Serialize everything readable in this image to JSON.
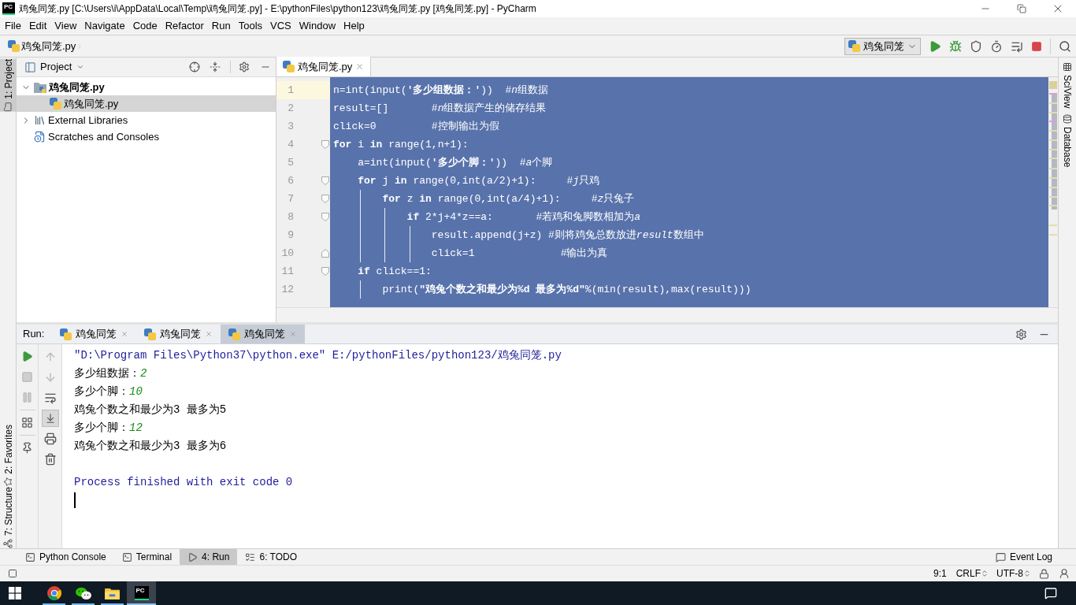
{
  "title_bar": {
    "logo": "PC",
    "title": "鸡兔同笼.py [C:\\Users\\i\\AppData\\Local\\Temp\\鸡兔同笼.py] - E:\\pythonFiles\\python123\\鸡兔同笼.py [鸡兔同笼.py] - PyCharm"
  },
  "menu": [
    "File",
    "Edit",
    "View",
    "Navigate",
    "Code",
    "Refactor",
    "Run",
    "Tools",
    "VCS",
    "Window",
    "Help"
  ],
  "breadcrumb": [
    "鸡兔同笼.py"
  ],
  "run_config": {
    "label": "鸡兔同笼"
  },
  "left_strip": [
    {
      "label": "1: Project",
      "kind": "project",
      "selected": true
    },
    {
      "label": "2: Favorites",
      "kind": "favorites",
      "selected": false
    },
    {
      "label": "7: Structure",
      "kind": "structure",
      "selected": false
    }
  ],
  "right_strip": [
    {
      "label": "SciView",
      "kind": "sciview"
    },
    {
      "label": "Database",
      "kind": "database"
    }
  ],
  "project": {
    "title": "Project",
    "tree": [
      {
        "label": "鸡兔同笼.py",
        "kind": "project",
        "expanded": true,
        "selected": false,
        "children": [
          {
            "label": "鸡兔同笼.py",
            "kind": "file",
            "selected": true
          }
        ]
      },
      {
        "label": "External Libraries",
        "kind": "libraries",
        "expanded": false,
        "selected": false
      },
      {
        "label": "Scratches and Consoles",
        "kind": "scratches",
        "selected": false
      }
    ]
  },
  "editor": {
    "tabs": [
      {
        "label": "鸡兔同笼.py",
        "selected": true
      }
    ],
    "lines": [
      {
        "number": "1",
        "kind": "plain",
        "current": true,
        "tokens": [
          {
            "kind": "plain",
            "text": "n=int(input("
          },
          {
            "kind": "str",
            "text": "'多少组数据：'"
          },
          {
            "kind": "plain",
            "text": "))  "
          },
          {
            "kind": "cmt",
            "text": "#"
          },
          {
            "kind": "cmtv",
            "text": "n"
          },
          {
            "kind": "cmt",
            "text": "组数据"
          }
        ]
      },
      {
        "number": "2",
        "kind": "plain",
        "current": false,
        "tokens": [
          {
            "kind": "plain",
            "text": "result=[]       "
          },
          {
            "kind": "cmt",
            "text": "#"
          },
          {
            "kind": "cmtv",
            "text": "n"
          },
          {
            "kind": "cmt",
            "text": "组数据产生的储存结果"
          }
        ]
      },
      {
        "number": "3",
        "kind": "plain",
        "current": false,
        "tokens": [
          {
            "kind": "plain",
            "text": "click=0         "
          },
          {
            "kind": "cmt",
            "text": "#控制输出为假"
          }
        ]
      },
      {
        "number": "4",
        "kind": "fold-start",
        "current": false,
        "tokens": [
          {
            "kind": "kw",
            "text": "for"
          },
          {
            "kind": "plain",
            "text": " i "
          },
          {
            "kind": "kw",
            "text": "in"
          },
          {
            "kind": "plain",
            "text": " range(1,n+1):"
          }
        ]
      },
      {
        "number": "5",
        "kind": "plain",
        "current": false,
        "tokens": [
          {
            "kind": "plain",
            "text": "    a=int(input("
          },
          {
            "kind": "str",
            "text": "'多少个脚：'"
          },
          {
            "kind": "plain",
            "text": "))  "
          },
          {
            "kind": "cmt",
            "text": "#"
          },
          {
            "kind": "cmtv",
            "text": "a"
          },
          {
            "kind": "cmt",
            "text": "个脚"
          }
        ]
      },
      {
        "number": "6",
        "kind": "fold-start",
        "current": false,
        "tokens": [
          {
            "kind": "kw",
            "text": "    for"
          },
          {
            "kind": "plain",
            "text": " j "
          },
          {
            "kind": "kw",
            "text": "in"
          },
          {
            "kind": "plain",
            "text": " range(0,int(a/2)+1):     "
          },
          {
            "kind": "cmt",
            "text": "#"
          },
          {
            "kind": "cmtv",
            "text": "j"
          },
          {
            "kind": "cmt",
            "text": "只鸡"
          }
        ]
      },
      {
        "number": "7",
        "kind": "fold-start",
        "current": false,
        "tokens": [
          {
            "kind": "kw",
            "text": "        for"
          },
          {
            "kind": "plain",
            "text": " z "
          },
          {
            "kind": "kw",
            "text": "in"
          },
          {
            "kind": "plain",
            "text": " range(0,int(a/4)+1):     "
          },
          {
            "kind": "cmt",
            "text": "#"
          },
          {
            "kind": "cmtv",
            "text": "z"
          },
          {
            "kind": "cmt",
            "text": "只兔子"
          }
        ]
      },
      {
        "number": "8",
        "kind": "fold-start",
        "current": false,
        "tokens": [
          {
            "kind": "kw",
            "text": "            if"
          },
          {
            "kind": "plain",
            "text": " 2*j+4*z==a:       "
          },
          {
            "kind": "cmt",
            "text": "#若鸡和兔脚数相加为"
          },
          {
            "kind": "cmtv",
            "text": "a"
          }
        ]
      },
      {
        "number": "9",
        "kind": "plain",
        "current": false,
        "tokens": [
          {
            "kind": "plain",
            "text": "                result.append(j+z) "
          },
          {
            "kind": "cmt",
            "text": "#则将鸡兔总数放进"
          },
          {
            "kind": "cmtv",
            "text": "result"
          },
          {
            "kind": "cmt",
            "text": "数组中"
          }
        ]
      },
      {
        "number": "10",
        "kind": "fold-end",
        "current": false,
        "tokens": [
          {
            "kind": "plain",
            "text": "                click=1              "
          },
          {
            "kind": "cmt",
            "text": "#输出为真"
          }
        ]
      },
      {
        "number": "11",
        "kind": "fold-start",
        "current": false,
        "tokens": [
          {
            "kind": "kw",
            "text": "    if"
          },
          {
            "kind": "plain",
            "text": " click==1:"
          }
        ]
      },
      {
        "number": "12",
        "kind": "plain",
        "current": false,
        "tokens": [
          {
            "kind": "plain",
            "text": "        print("
          },
          {
            "kind": "str",
            "text": "\"鸡兔个数之和最少为%d 最多为%d\""
          },
          {
            "kind": "plain",
            "text": "%(min(result),max(result)))"
          }
        ]
      }
    ]
  },
  "run": {
    "title": "Run:",
    "tabs": [
      {
        "label": "鸡兔同笼",
        "selected": false
      },
      {
        "label": "鸡兔同笼",
        "selected": false
      },
      {
        "label": "鸡兔同笼",
        "selected": true
      }
    ],
    "toolbar_left": [
      {
        "kind": "rerun",
        "disabled": false
      },
      {
        "kind": "stop",
        "disabled": true
      },
      {
        "kind": "pause",
        "disabled": true
      },
      {
        "kind": "layout",
        "disabled": false
      },
      {
        "kind": "pin",
        "disabled": false
      }
    ],
    "toolbar_right": [
      {
        "kind": "up",
        "disabled": true,
        "on": false
      },
      {
        "kind": "down",
        "disabled": true,
        "on": false
      },
      {
        "kind": "wrap",
        "disabled": false,
        "on": false
      },
      {
        "kind": "scroll-end",
        "disabled": false,
        "on": true
      },
      {
        "kind": "print",
        "disabled": false,
        "on": false
      },
      {
        "kind": "trash",
        "disabled": false,
        "on": false
      }
    ],
    "output": [
      {
        "kind": "command",
        "text": "\"D:\\Program Files\\Python37\\python.exe\" E:/pythonFiles/python123/鸡兔同笼.py"
      },
      {
        "kind": "prompt",
        "text": "多少组数据：",
        "input": "2"
      },
      {
        "kind": "prompt",
        "text": "多少个脚：",
        "input": "10"
      },
      {
        "kind": "output",
        "text": "鸡兔个数之和最少为3 最多为5"
      },
      {
        "kind": "prompt",
        "text": "多少个脚：",
        "input": "12"
      },
      {
        "kind": "output",
        "text": "鸡兔个数之和最少为3 最多为6"
      },
      {
        "kind": "exit",
        "text": "Process finished with exit code 0"
      }
    ]
  },
  "tool_windows": [
    {
      "label": "Python Console",
      "kind": "console",
      "selected": false
    },
    {
      "label": "Terminal",
      "kind": "terminal",
      "selected": false
    },
    {
      "label": "4: Run",
      "kind": "run",
      "selected": true
    },
    {
      "label": "6: TODO",
      "kind": "todo",
      "selected": false
    }
  ],
  "event_log": {
    "label": "Event Log"
  },
  "status_bar": {
    "position": "9:1",
    "line_separator": "CRLF",
    "encoding": "UTF-8"
  },
  "taskbar": {
    "apps": [
      {
        "kind": "chrome",
        "running": true,
        "selected": false
      },
      {
        "kind": "wechat",
        "running": true,
        "selected": false
      },
      {
        "kind": "explorer",
        "running": true,
        "selected": false
      },
      {
        "kind": "pycharm",
        "label": "PC",
        "running": true,
        "selected": true
      }
    ]
  }
}
